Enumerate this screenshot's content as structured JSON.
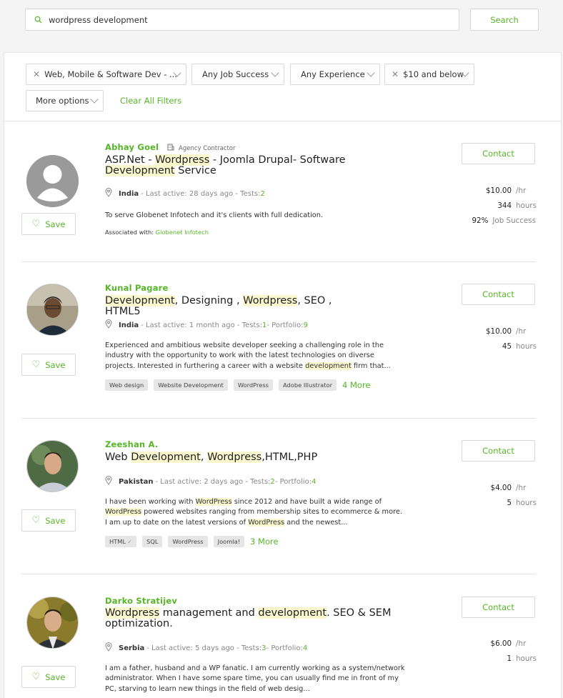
{
  "search": {
    "value": "wordpress development",
    "button": "Search"
  },
  "filters": {
    "chips": [
      "Web, Mobile & Software Dev - ...",
      "Any Job Success",
      "Any Experience",
      "$10 and below",
      "More options"
    ],
    "clear": "Clear All Filters"
  },
  "colors": {
    "accent": "#57b528",
    "highlight": "#fbf8cf"
  },
  "freelancers": [
    {
      "name": "Abhay Goel",
      "badge": "Agency Contractor",
      "title": [
        "ASP.Net - ",
        "Wordpress",
        " - Joomla Drupal- Software ",
        "Development",
        " Service"
      ],
      "country": "India",
      "meta": " - Last active: 28 days ago - Tests: ",
      "tests": "2",
      "desc": "To serve Globenet Infotech and it's clients with full dedication.",
      "assoc_label": "Associated with: ",
      "assoc_name": "Globenet Infotech",
      "rate": "$10.00",
      "rate_unit": "/hr",
      "hours": "344",
      "hours_unit": "hours",
      "job_success": "92%",
      "job_success_label": "Job Success",
      "contact": "Contact",
      "save": "Save"
    },
    {
      "name": "Kunal Pagare",
      "title": [
        "Development",
        ", Designing , ",
        "Wordpress",
        ", SEO , HTML5"
      ],
      "country": "India",
      "meta": " - Last active: 1 month ago - Tests: ",
      "tests": "1",
      "portfolio_label": " - Portfolio: ",
      "portfolio": "9",
      "desc": [
        "Experienced and ambitious website developer seeking a challenging role in the industry with the opportunity to work with the latest technologies on diverse projects. Interested in furthering a career with a website ",
        "development",
        " firm that..."
      ],
      "tags": [
        "Web design",
        "Website Development",
        "WordPress",
        "Adobe Illustrator"
      ],
      "more": "4 More",
      "rate": "$10.00",
      "rate_unit": "/hr",
      "hours": "45",
      "hours_unit": "hours",
      "contact": "Contact",
      "save": "Save"
    },
    {
      "name": "Zeeshan A.",
      "title": [
        "Web ",
        "Development",
        ", ",
        "Wordpress",
        ",HTML,PHP"
      ],
      "country": "Pakistan",
      "meta": " - Last active: 2 days ago - Tests: ",
      "tests": "2",
      "portfolio_label": " - Portfolio: ",
      "portfolio": "4",
      "desc": [
        "I have been working with ",
        "WordPress",
        " since 2012 and have built a wide range of ",
        "WordPress",
        " powered websites ranging from membership sites to ecommerce & more. I am up to date on the latest versions of ",
        "WordPress",
        " and the newest..."
      ],
      "tags": [
        "HTML",
        "SQL",
        "WordPress",
        "Joomla!"
      ],
      "more": "3 More",
      "rate": "$4.00",
      "rate_unit": "/hr",
      "hours": "5",
      "hours_unit": "hours",
      "contact": "Contact",
      "save": "Save"
    },
    {
      "name": "Darko Stratijev",
      "title": [
        "Wordpress",
        " management and ",
        "development",
        ". SEO & SEM optimization."
      ],
      "country": "Serbia",
      "meta": " - Last active: 5 days ago - Tests: ",
      "tests": "3",
      "portfolio_label": " - Portfolio: ",
      "portfolio": "4",
      "desc": "I am a father, husband and a WP fanatic. I am currently working as a system/network administrator. When I have some spare time, you can usually find me in front of my PC, starving to learn new things in the field of web desig...",
      "rate": "$6.00",
      "rate_unit": "/hr",
      "hours": "1",
      "hours_unit": "hours",
      "contact": "Contact",
      "save": "Save"
    }
  ]
}
